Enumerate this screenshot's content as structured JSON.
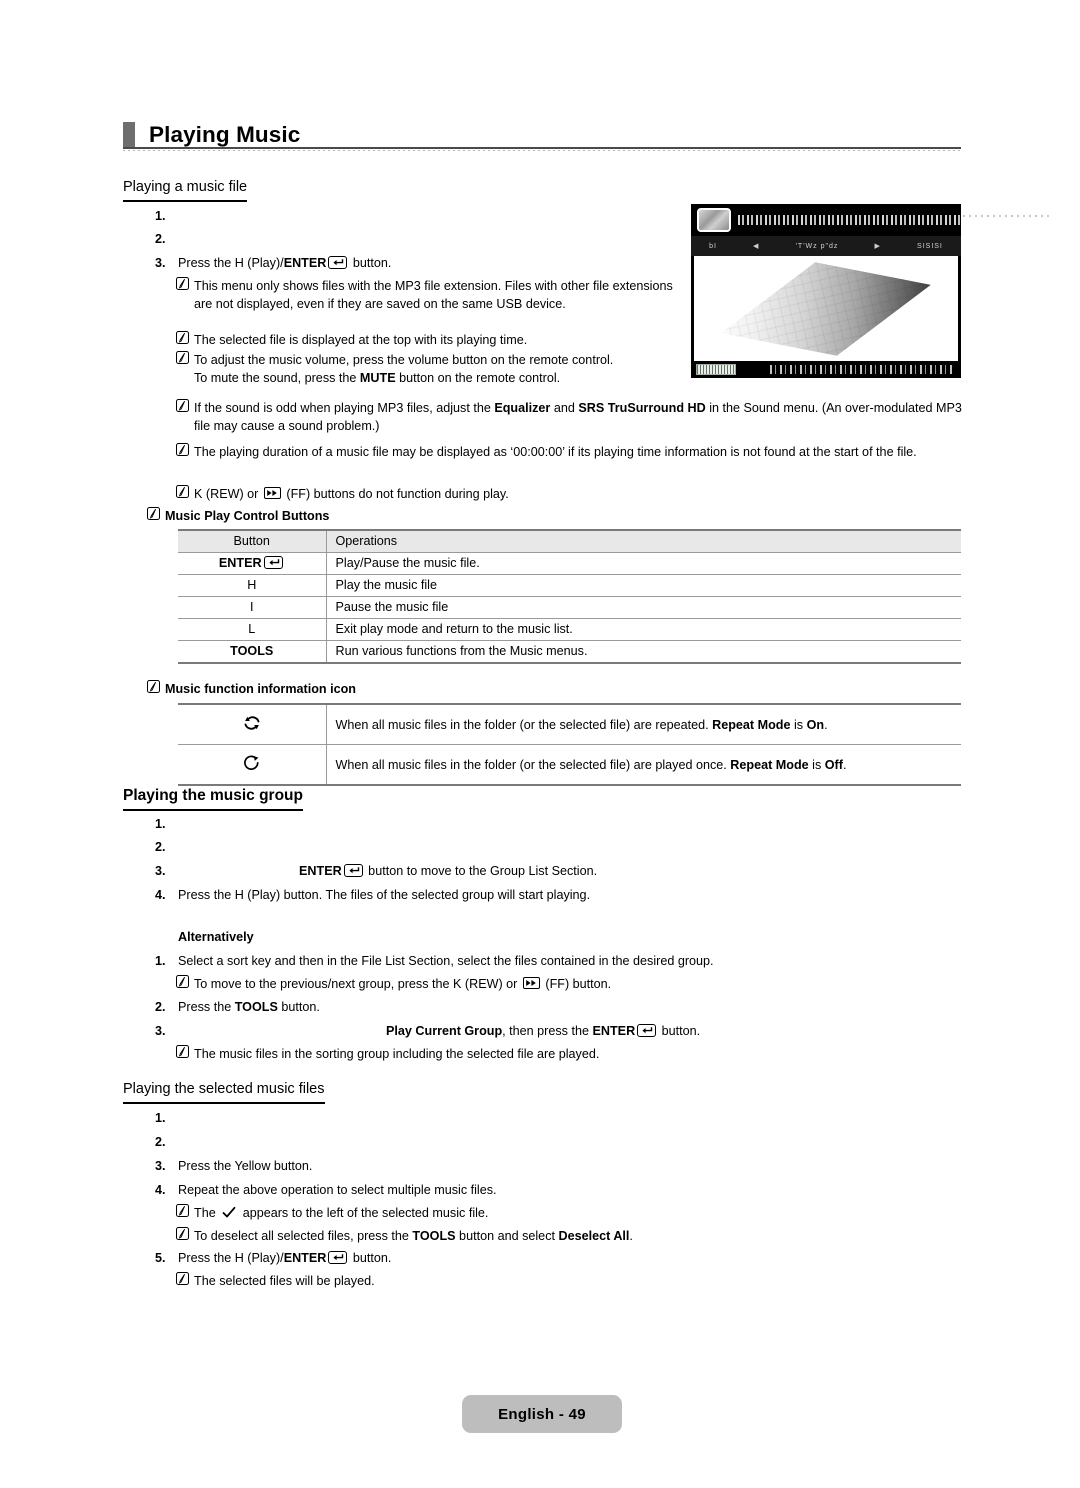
{
  "page": {
    "chapter_title": "Playing Music",
    "footer_label": "English - 49",
    "accent_gray": "#6e6e6e",
    "table_header_bg": "#e8e8e8",
    "footer_bg": "#bdbdbd"
  },
  "sections": {
    "playing_a_music_file": {
      "heading": "Playing a music file",
      "steps": [
        {
          "num": "1.",
          "text": ""
        },
        {
          "num": "2.",
          "text": ""
        },
        {
          "num": "3.",
          "pre": "Press the  H   (Play)/",
          "bold": "ENTER",
          "icon": "enter-icon",
          "post": " button."
        }
      ],
      "notes": [
        "This menu only shows files with the MP3 file extension. Files with other file extensions are not displayed, even if they are saved on the same USB device.",
        "The selected file is displayed at the top with its playing time."
      ],
      "note_volume": {
        "line1_pre": "To adjust the music volume, press the volume button on the remote control.",
        "line2_pre": "To mute the sound, press the ",
        "line2_bold": "MUTE",
        "line2_post": " button on the remote control."
      },
      "note_sound": {
        "pre": "If the sound is odd when playing MP3 files, adjust the ",
        "bold1": "Equalizer",
        "mid": " and ",
        "bold2": "SRS TruSurround HD",
        "post": " in the Sound menu. (An over-modulated MP3 file may cause a sound problem.)"
      },
      "note_duration": "The playing duration of a music file may be displayed as ‘00:00:00’ if its playing time information is not found at the start of the file.",
      "note_rew": {
        "pre": " K   (REW) or ",
        "icon": "fast-forward-icon",
        "post": " (FF) buttons do not function during play."
      }
    },
    "music_play_control_buttons": {
      "note_label": "Music Play Control Buttons",
      "columns": [
        "Button",
        "Operations"
      ],
      "rows": [
        {
          "button": "ENTER",
          "button_icon": "enter-icon",
          "button_bold": true,
          "operation": "Play/Pause the music file."
        },
        {
          "button": "H",
          "button_bold": false,
          "operation": "Play the music file"
        },
        {
          "button": "I",
          "button_bold": false,
          "operation": "Pause the music file"
        },
        {
          "button": "L",
          "button_bold": false,
          "operation": "Exit play mode and return to the music list."
        },
        {
          "button": "TOOLS",
          "button_bold": true,
          "operation": "Run various functions from the Music menus."
        }
      ]
    },
    "music_function_information_icon": {
      "note_label": "Music function information icon",
      "rows": [
        {
          "icon": "repeat-all-icon",
          "pre": "When all music files in the folder (or the selected file) are repeated. ",
          "bold1": "Repeat Mode",
          "mid": " is ",
          "bold2": "On",
          "post": "."
        },
        {
          "icon": "repeat-once-icon",
          "pre": "When all music files in the folder (or the selected file) are played once. ",
          "bold1": "Repeat Mode",
          "mid": " is ",
          "bold2": "Off",
          "post": "."
        }
      ]
    },
    "playing_the_music_group": {
      "heading": "Playing the music group",
      "steps": [
        {
          "num": "1.",
          "text": ""
        },
        {
          "num": "2.",
          "text": ""
        },
        {
          "num": "3.",
          "bold": "ENTER",
          "icon": "enter-icon",
          "post": " button to move to the Group List Section."
        },
        {
          "num": "4.",
          "text": "Press the  H   (Play) button. The files of the selected group will start playing."
        }
      ],
      "alternatively_label": "Alternatively",
      "alt_steps": [
        {
          "num": "1.",
          "text": "Select a sort key and then in the File List Section, select the files contained in the desired group."
        },
        {
          "num": "2.",
          "pre": "Press the ",
          "bold": "TOOLS",
          "post": " button."
        },
        {
          "num": "3.",
          "bold1": "Play Current Group",
          "mid": ", then press the ",
          "bold2": "ENTER",
          "icon": "enter-icon",
          "post": " button."
        }
      ],
      "alt_note_move": {
        "pre": "To move to the previous/next group, press the  K   (REW) or ",
        "icon": "fast-forward-icon",
        "post": " (FF) button."
      },
      "alt_note_sorting": "The music files in the sorting group including the selected file are played."
    },
    "playing_the_selected_music_files": {
      "heading": "Playing the selected music files",
      "steps": [
        {
          "num": "1.",
          "text": ""
        },
        {
          "num": "2.",
          "text": ""
        },
        {
          "num": "3.",
          "text": "Press the Yellow button."
        },
        {
          "num": "4.",
          "text": "Repeat the above operation to select multiple music files."
        },
        {
          "num": "5.",
          "pre": "Press the  H   (Play)/",
          "bold": "ENTER",
          "icon": "enter-icon",
          "post": " button."
        }
      ],
      "note_check": {
        "pre": "The ",
        "icon": "check-icon",
        "post": " appears to the left of the selected music file."
      },
      "note_deselect": {
        "pre": "To deselect all selected files, press the ",
        "bold1": "TOOLS",
        "mid": " button and select ",
        "bold2": "Deselect All",
        "post": "."
      },
      "note_played": "The selected files will be played."
    }
  },
  "tv_screenshot": {
    "name": "music-player-osd",
    "menu_items": [
      "bI",
      "◀",
      "'T'Wz p\"dz",
      "▶",
      "SISISI"
    ]
  }
}
